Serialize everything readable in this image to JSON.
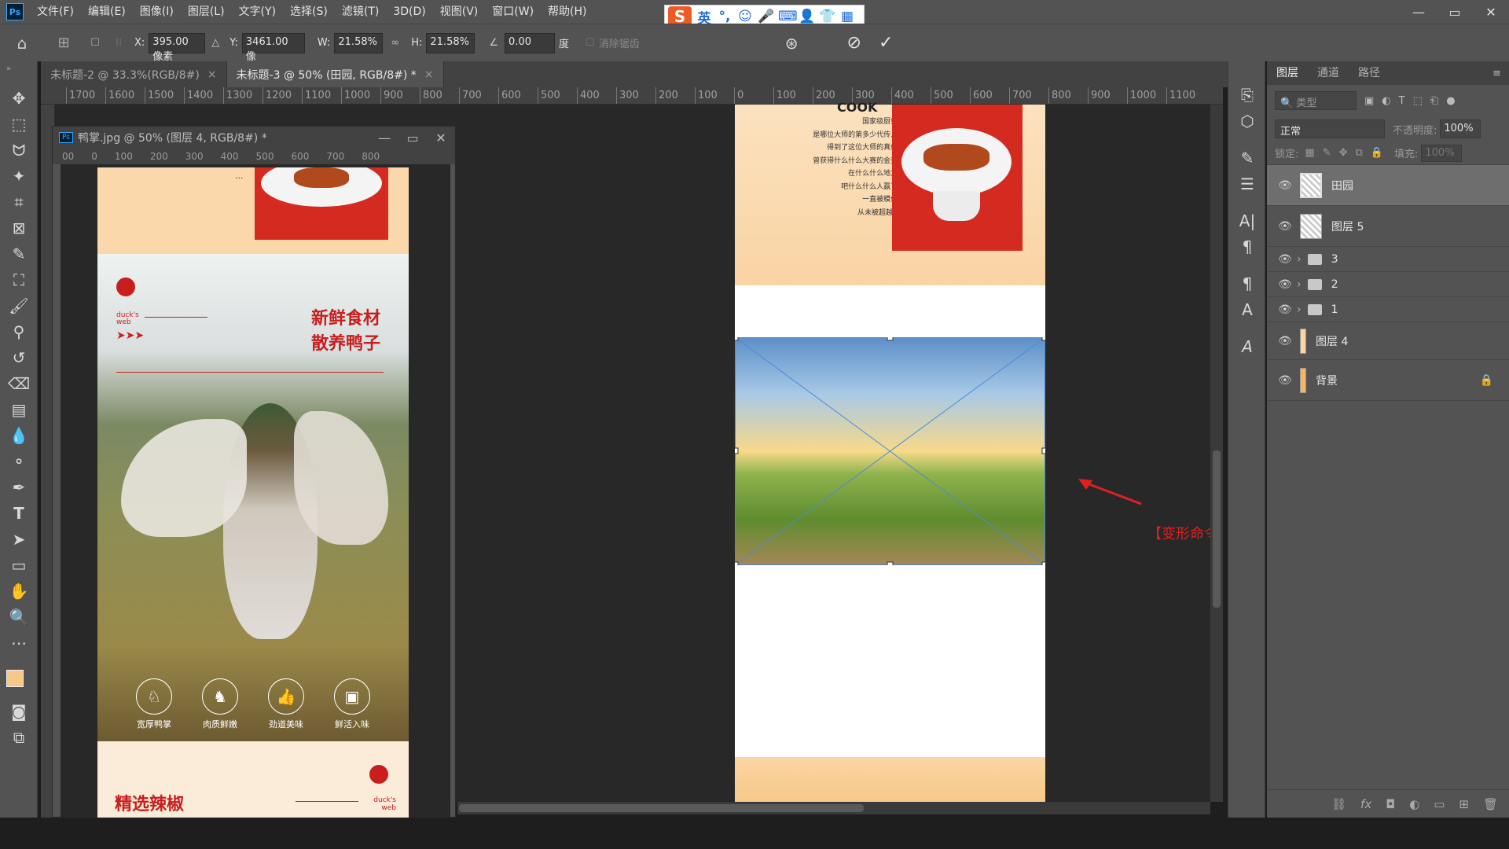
{
  "app": {
    "logo": "Ps"
  },
  "menu": [
    "文件(F)",
    "编辑(E)",
    "图像(I)",
    "图层(L)",
    "文字(Y)",
    "选择(S)",
    "滤镜(T)",
    "3D(D)",
    "视图(V)",
    "窗口(W)",
    "帮助(H)"
  ],
  "window_controls": {
    "minimize": "—",
    "maximize": "▭",
    "close": "✕"
  },
  "ime": {
    "logo": "S",
    "mode": "英"
  },
  "options": {
    "x_label": "X:",
    "x_value": "395.00 像素",
    "y_label": "Y:",
    "y_value": "3461.00 像",
    "w_label": "W:",
    "w_value": "21.58%",
    "h_label": "H:",
    "h_value": "21.58%",
    "angle_value": "0.00",
    "angle_unit": "度",
    "antialias": "消除锯齿"
  },
  "tabs": [
    {
      "label": "未标题-2 @ 33.3%(RGB/8#)",
      "close": "×"
    },
    {
      "label": "未标题-3 @ 50% (田园, RGB/8#) *",
      "close": "×"
    }
  ],
  "ruler_top": [
    "1700",
    "1600",
    "1500",
    "1400",
    "1300",
    "1200",
    "1100",
    "1000",
    "900",
    "800",
    "700",
    "600",
    "500",
    "400",
    "300",
    "200",
    "100",
    "0",
    "100",
    "200",
    "300",
    "400",
    "500",
    "600",
    "700",
    "800",
    "900",
    "1000",
    "1100"
  ],
  "float_window": {
    "title": "鸭掌.jpg @ 50% (图层 4, RGB/8#) *",
    "ruler": [
      "00",
      "0",
      "100",
      "200",
      "300",
      "400",
      "500",
      "600",
      "700",
      "800"
    ],
    "badge1": "duck's web",
    "heading1": "新鲜食材",
    "heading2": "散养鸭子",
    "icons": [
      "宽厚鸭掌",
      "肉质鲜嫩",
      "劲道美味",
      "鲜活入味"
    ],
    "bottom_heading": "精选辣椒",
    "bottom_badge": "duck's web",
    "ellipsis": "..."
  },
  "doc_text": {
    "cook": "COOK",
    "lines": [
      "国家级厨师,",
      "是哪位大师的第多少代传人,",
      "得到了这位大师的真传,",
      "曾获得什么什么大赛的金奖,",
      "在什么什么地方,",
      "吧什么什么人赢了,",
      "一直被模仿,",
      "从未被超越。"
    ]
  },
  "annotation": "【变形命令】",
  "layers_panel": {
    "tabs": [
      "图层",
      "通道",
      "路径"
    ],
    "filter_placeholder": "类型",
    "blend_mode": "正常",
    "opacity_label": "不透明度:",
    "opacity_value": "100%",
    "lock_label": "锁定:",
    "fill_label": "填充:",
    "fill_value": "100%",
    "layers": [
      {
        "name": "田园"
      },
      {
        "name": "图层 5"
      },
      {
        "name": "3"
      },
      {
        "name": "2"
      },
      {
        "name": "1"
      },
      {
        "name": "图层 4"
      },
      {
        "name": "背景"
      }
    ],
    "bottom_icons": [
      "link-icon",
      "fx-icon",
      "mask-icon",
      "adjust-icon",
      "folder-icon",
      "new-layer-icon",
      "trash-icon"
    ]
  }
}
